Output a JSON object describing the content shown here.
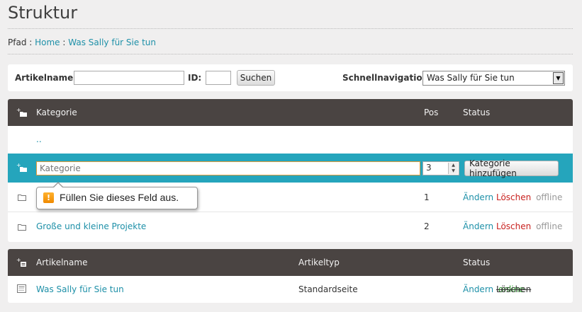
{
  "page": {
    "title": "Struktur"
  },
  "breadcrumb": {
    "label": "Pfad :",
    "items": [
      "Home",
      "Was Sally für Sie tun"
    ],
    "separator": ":"
  },
  "search": {
    "article_label": "Artikelname:",
    "article_value": "",
    "id_label": "ID:",
    "id_value": "",
    "search_button": "Suchen",
    "quicknav_label": "Schnellnavigation",
    "quicknav_selected": "Was Sally für Sie tun"
  },
  "categories": {
    "headers": {
      "name": "Kategorie",
      "pos": "Pos",
      "status": "Status"
    },
    "parent_link": "..",
    "add_row": {
      "placeholder": "Kategorie",
      "pos_value": "3",
      "button": "Kategorie hinzufügen"
    },
    "rows": [
      {
        "name": "",
        "pos": "1",
        "edit": "Ändern",
        "delete": "Löschen",
        "state": "offline"
      },
      {
        "name": "Große und kleine Projekte",
        "pos": "2",
        "edit": "Ändern",
        "delete": "Löschen",
        "state": "offline"
      }
    ]
  },
  "validation_tooltip": {
    "message": "Füllen Sie dieses Feld aus."
  },
  "articles": {
    "headers": {
      "name": "Artikelname",
      "type": "Artikeltyp",
      "status": "Status"
    },
    "rows": [
      {
        "name": "Was Sally für Sie tun",
        "type": "Standardseite",
        "edit": "Ändern",
        "delete": "Löschen",
        "state": "online"
      }
    ]
  },
  "colors": {
    "header_bg": "#4a4442",
    "accent": "#25a5bc",
    "link": "#1e90a8",
    "delete": "#c8201e",
    "online": "#2a9a2a",
    "page_bg": "#f0efef"
  },
  "icons": {
    "add_category": "folder-plus-icon",
    "category": "folder-icon",
    "add_article": "page-plus-icon",
    "article": "page-icon",
    "warning": "warning-icon",
    "select_arrow": "chevron-down-icon"
  }
}
